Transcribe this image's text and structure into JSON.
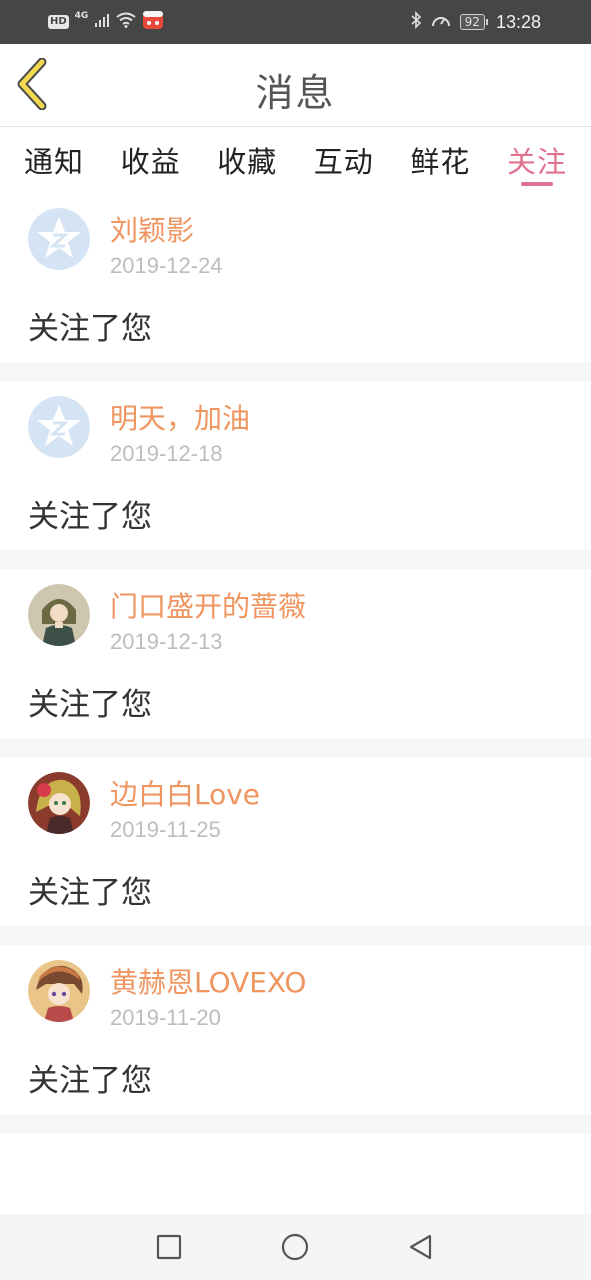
{
  "status_bar": {
    "hd_label": "HD",
    "network_label": "4G",
    "battery_level": "92",
    "time": "13:28"
  },
  "header": {
    "title": "消息"
  },
  "tabs": [
    {
      "label": "通知",
      "active": false
    },
    {
      "label": "收益",
      "active": false
    },
    {
      "label": "收藏",
      "active": false
    },
    {
      "label": "互动",
      "active": false
    },
    {
      "label": "鲜花",
      "active": false
    },
    {
      "label": "关注",
      "active": true
    }
  ],
  "messages": [
    {
      "name": "刘颖影",
      "date": "2019-12-24",
      "text": "关注了您",
      "avatar": "default-star-avatar"
    },
    {
      "name": "明天，加油",
      "date": "2019-12-18",
      "text": "关注了您",
      "avatar": "default-star-avatar"
    },
    {
      "name": "门口盛开的蔷薇",
      "date": "2019-12-13",
      "text": "关注了您",
      "avatar": "anime-girl-avatar"
    },
    {
      "name": "边白白Love",
      "date": "2019-11-25",
      "text": "关注了您",
      "avatar": "anime-girl-avatar"
    },
    {
      "name": "黄赫恩LOVEXO",
      "date": "2019-11-20",
      "text": "关注了您",
      "avatar": "anime-girl-avatar"
    }
  ],
  "colors": {
    "accent_pink": "#e2708f",
    "name_orange": "#ef9560",
    "back_arrow_yellow": "#f2d94e",
    "status_bar_bg": "#464646",
    "separator_gray": "#f7f6f7"
  },
  "nav_bar": {
    "icons": [
      "recent-apps-icon",
      "home-icon",
      "back-triangle-icon"
    ]
  }
}
